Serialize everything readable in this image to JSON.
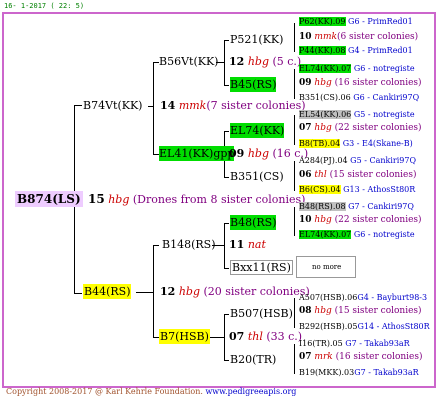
{
  "header": "16-  1-2017 ( 22:  5)",
  "footer": {
    "copyright": "Copyright 2008-2017 @ Karl Kehrle Foundation.",
    "site": "www.pedigreeapis.org"
  },
  "colors": {
    "border": "#cc66cc",
    "green": "#00dd00",
    "yellow": "#ffff00",
    "gray": "#c0c0c0",
    "pink": "#eeccff"
  },
  "root": {
    "name": "B874(LS)",
    "num": "15",
    "label": "hbg",
    "siblings": "(Drones from 8 sister colonies)"
  },
  "gen1": {
    "upper": {
      "name": "B74Vt(KK)",
      "num": "14",
      "label": "mmk",
      "siblings": "(7 sister colonies)"
    },
    "lower": {
      "name": "B44(RS)",
      "num": "12",
      "label": "hbg",
      "siblings": "(20 sister colonies)"
    }
  },
  "gen2": {
    "a": {
      "name": "B56Vt(KK)",
      "num": "12",
      "label": "hbg",
      "siblings": "(5 c.)"
    },
    "b": {
      "name": "EL41(KK)gpp",
      "num": "09",
      "label": "hbg",
      "siblings": "(16 c.)"
    },
    "c": {
      "name": "B148(RS)",
      "num": "11",
      "label": "nat"
    },
    "d": {
      "name": "B7(HSB)",
      "num": "07",
      "label": "thl",
      "siblings": "(33 c.)"
    }
  },
  "gen3": {
    "a": {
      "name": "P521(KK)",
      "num": "10",
      "label": "mmk",
      "siblings": "(6 sister colonies)"
    },
    "b": {
      "name": "B45(RS)",
      "num": "09",
      "label": "hbg",
      "siblings": "(16 sister colonies)"
    },
    "c": {
      "name": "EL74(KK)",
      "num": "07",
      "label": "hbg",
      "siblings": "(22 sister colonies)"
    },
    "d": {
      "name": "B351(CS)",
      "num": "06",
      "label": "thl",
      "siblings": "(15 sister colonies)"
    },
    "e": {
      "name": "B48(RS)",
      "num": "10",
      "label": "hbg",
      "siblings": "(22 sister colonies)"
    },
    "f": {
      "name": "Bxx11(RS)",
      "extra": "no more"
    },
    "g": {
      "name": "B507(HSB)",
      "num": "08",
      "label": "hbg",
      "siblings": "(15 sister colonies)"
    },
    "h": {
      "name": "B20(TR)",
      "num": "07",
      "label": "mrk",
      "siblings": "(16 sister colonies)"
    }
  },
  "gen4": [
    {
      "name": "P62(KK)",
      "year": ".09",
      "code": "G6 - PrimRed01"
    },
    {
      "name": "P44(KK)",
      "year": ".08",
      "code": "G4 - PrimRed01"
    },
    {
      "name": "EL74(KK)",
      "year": ".07",
      "code": "G6 - notregiste"
    },
    {
      "name": "B351(CS)",
      "year": ".06",
      "code": "G6 - Cankiri97Q"
    },
    {
      "name": "EL54(KK)",
      "year": ".06",
      "code": "G5 - notregiste"
    },
    {
      "name": "B8(TB)",
      "year": ".04",
      "code": "G3 - E4(Skane-B)"
    },
    {
      "name": "A284(PJ)",
      "year": ".04",
      "code": "G5 - Cankiri97Q"
    },
    {
      "name": "B6(CS)",
      "year": ".04",
      "code": "G13 - AthosSt80R"
    },
    {
      "name": "B48(RS)",
      "year": ".08",
      "code": "G7 - Cankiri97Q"
    },
    {
      "name": "EL74(KK)",
      "year": ".07",
      "code": "G6 - notregiste"
    },
    {
      "name": "A507(HSB)",
      "year": ".06",
      "code": "G4 - Bayburt98-3"
    },
    {
      "name": "B292(HSB)",
      "year": ".05",
      "code": "G14 - AthosSt80R"
    },
    {
      "name": "I16(TR)",
      "year": ".05",
      "code": "G7 - Takab93aR"
    },
    {
      "name": "B19(MKK)",
      "year": ".03",
      "code": "G7 - Takab93aR"
    }
  ]
}
